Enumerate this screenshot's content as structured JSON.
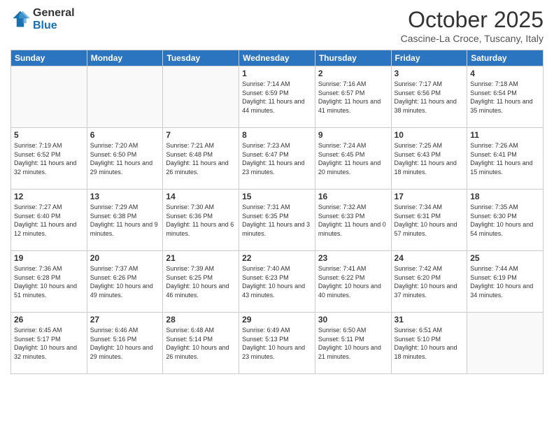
{
  "logo": {
    "general": "General",
    "blue": "Blue"
  },
  "header": {
    "month": "October 2025",
    "location": "Cascine-La Croce, Tuscany, Italy"
  },
  "weekdays": [
    "Sunday",
    "Monday",
    "Tuesday",
    "Wednesday",
    "Thursday",
    "Friday",
    "Saturday"
  ],
  "weeks": [
    [
      {
        "day": "",
        "info": ""
      },
      {
        "day": "",
        "info": ""
      },
      {
        "day": "",
        "info": ""
      },
      {
        "day": "1",
        "info": "Sunrise: 7:14 AM\nSunset: 6:59 PM\nDaylight: 11 hours and 44 minutes."
      },
      {
        "day": "2",
        "info": "Sunrise: 7:16 AM\nSunset: 6:57 PM\nDaylight: 11 hours and 41 minutes."
      },
      {
        "day": "3",
        "info": "Sunrise: 7:17 AM\nSunset: 6:56 PM\nDaylight: 11 hours and 38 minutes."
      },
      {
        "day": "4",
        "info": "Sunrise: 7:18 AM\nSunset: 6:54 PM\nDaylight: 11 hours and 35 minutes."
      }
    ],
    [
      {
        "day": "5",
        "info": "Sunrise: 7:19 AM\nSunset: 6:52 PM\nDaylight: 11 hours and 32 minutes."
      },
      {
        "day": "6",
        "info": "Sunrise: 7:20 AM\nSunset: 6:50 PM\nDaylight: 11 hours and 29 minutes."
      },
      {
        "day": "7",
        "info": "Sunrise: 7:21 AM\nSunset: 6:48 PM\nDaylight: 11 hours and 26 minutes."
      },
      {
        "day": "8",
        "info": "Sunrise: 7:23 AM\nSunset: 6:47 PM\nDaylight: 11 hours and 23 minutes."
      },
      {
        "day": "9",
        "info": "Sunrise: 7:24 AM\nSunset: 6:45 PM\nDaylight: 11 hours and 20 minutes."
      },
      {
        "day": "10",
        "info": "Sunrise: 7:25 AM\nSunset: 6:43 PM\nDaylight: 11 hours and 18 minutes."
      },
      {
        "day": "11",
        "info": "Sunrise: 7:26 AM\nSunset: 6:41 PM\nDaylight: 11 hours and 15 minutes."
      }
    ],
    [
      {
        "day": "12",
        "info": "Sunrise: 7:27 AM\nSunset: 6:40 PM\nDaylight: 11 hours and 12 minutes."
      },
      {
        "day": "13",
        "info": "Sunrise: 7:29 AM\nSunset: 6:38 PM\nDaylight: 11 hours and 9 minutes."
      },
      {
        "day": "14",
        "info": "Sunrise: 7:30 AM\nSunset: 6:36 PM\nDaylight: 11 hours and 6 minutes."
      },
      {
        "day": "15",
        "info": "Sunrise: 7:31 AM\nSunset: 6:35 PM\nDaylight: 11 hours and 3 minutes."
      },
      {
        "day": "16",
        "info": "Sunrise: 7:32 AM\nSunset: 6:33 PM\nDaylight: 11 hours and 0 minutes."
      },
      {
        "day": "17",
        "info": "Sunrise: 7:34 AM\nSunset: 6:31 PM\nDaylight: 10 hours and 57 minutes."
      },
      {
        "day": "18",
        "info": "Sunrise: 7:35 AM\nSunset: 6:30 PM\nDaylight: 10 hours and 54 minutes."
      }
    ],
    [
      {
        "day": "19",
        "info": "Sunrise: 7:36 AM\nSunset: 6:28 PM\nDaylight: 10 hours and 51 minutes."
      },
      {
        "day": "20",
        "info": "Sunrise: 7:37 AM\nSunset: 6:26 PM\nDaylight: 10 hours and 49 minutes."
      },
      {
        "day": "21",
        "info": "Sunrise: 7:39 AM\nSunset: 6:25 PM\nDaylight: 10 hours and 46 minutes."
      },
      {
        "day": "22",
        "info": "Sunrise: 7:40 AM\nSunset: 6:23 PM\nDaylight: 10 hours and 43 minutes."
      },
      {
        "day": "23",
        "info": "Sunrise: 7:41 AM\nSunset: 6:22 PM\nDaylight: 10 hours and 40 minutes."
      },
      {
        "day": "24",
        "info": "Sunrise: 7:42 AM\nSunset: 6:20 PM\nDaylight: 10 hours and 37 minutes."
      },
      {
        "day": "25",
        "info": "Sunrise: 7:44 AM\nSunset: 6:19 PM\nDaylight: 10 hours and 34 minutes."
      }
    ],
    [
      {
        "day": "26",
        "info": "Sunrise: 6:45 AM\nSunset: 5:17 PM\nDaylight: 10 hours and 32 minutes."
      },
      {
        "day": "27",
        "info": "Sunrise: 6:46 AM\nSunset: 5:16 PM\nDaylight: 10 hours and 29 minutes."
      },
      {
        "day": "28",
        "info": "Sunrise: 6:48 AM\nSunset: 5:14 PM\nDaylight: 10 hours and 26 minutes."
      },
      {
        "day": "29",
        "info": "Sunrise: 6:49 AM\nSunset: 5:13 PM\nDaylight: 10 hours and 23 minutes."
      },
      {
        "day": "30",
        "info": "Sunrise: 6:50 AM\nSunset: 5:11 PM\nDaylight: 10 hours and 21 minutes."
      },
      {
        "day": "31",
        "info": "Sunrise: 6:51 AM\nSunset: 5:10 PM\nDaylight: 10 hours and 18 minutes."
      },
      {
        "day": "",
        "info": ""
      }
    ]
  ]
}
